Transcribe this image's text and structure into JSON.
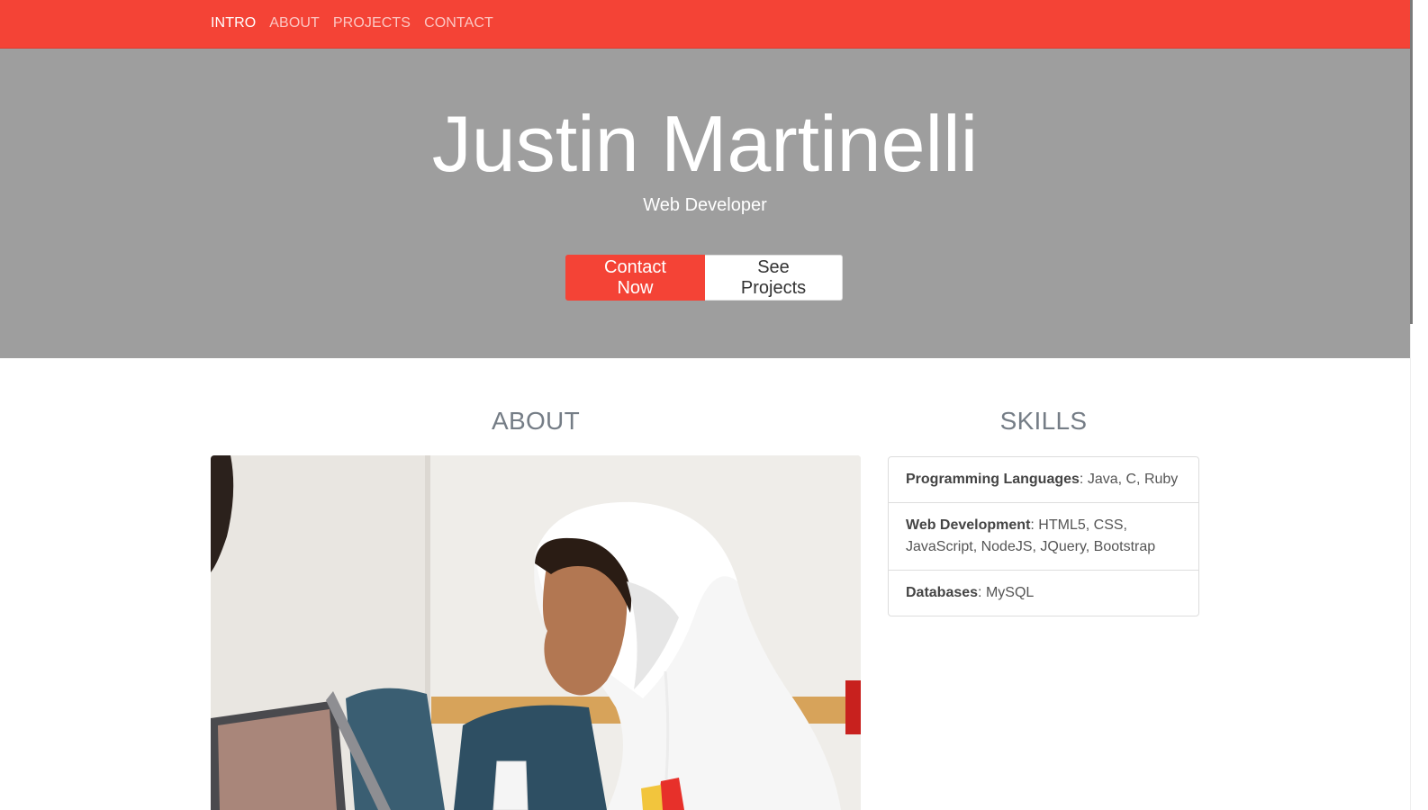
{
  "nav": {
    "items": [
      {
        "label": "INTRO",
        "active": true
      },
      {
        "label": "ABOUT",
        "active": false
      },
      {
        "label": "PROJECTS",
        "active": false
      },
      {
        "label": "CONTACT",
        "active": false
      }
    ]
  },
  "hero": {
    "title": "Justin Martinelli",
    "subtitle": "Web Developer",
    "primary_button": "Contact Now",
    "secondary_button": "See Projects"
  },
  "about": {
    "heading": "ABOUT"
  },
  "skills": {
    "heading": "SKILLS",
    "items": [
      {
        "name": "Programming Languages",
        "value": ": Java, C, Ruby"
      },
      {
        "name": "Web Development",
        "value": ": HTML5, CSS, JavaScript, NodeJS, JQuery, Bootstrap"
      },
      {
        "name": "Databases",
        "value": ": MySQL"
      }
    ]
  },
  "colors": {
    "accent": "#f44336",
    "hero_bg": "#9e9e9e",
    "heading": "#757d86"
  }
}
